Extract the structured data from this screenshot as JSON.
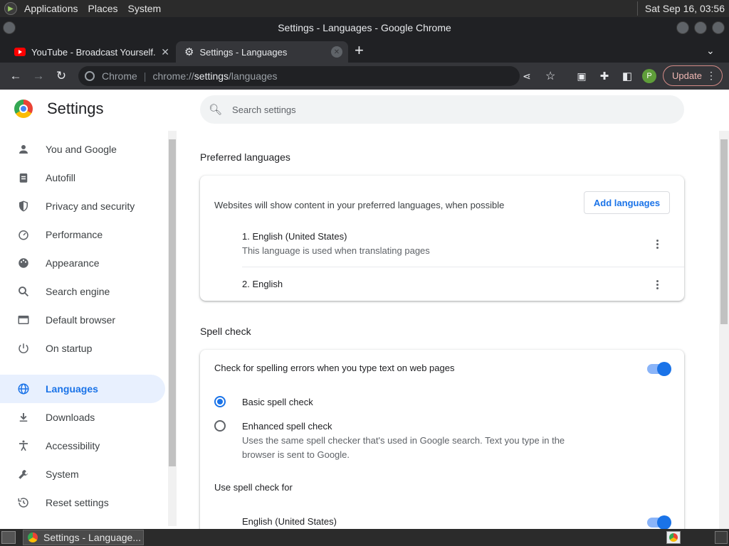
{
  "top_panel": {
    "menus": [
      "Applications",
      "Places",
      "System"
    ],
    "clock": "Sat Sep 16, 03:56"
  },
  "window": {
    "title": "Settings - Languages - Google Chrome"
  },
  "tabs": [
    {
      "title": "YouTube - Broadcast Yourself.",
      "icon": "youtube-icon",
      "active": false
    },
    {
      "title": "Settings - Languages",
      "icon": "gear-icon",
      "active": true
    }
  ],
  "toolbar": {
    "omnibox_site": "Chrome",
    "omnibox_url_prefix": "chrome://",
    "omnibox_url_host": "settings",
    "omnibox_url_path": "/languages",
    "profile_initial": "P",
    "update_label": "Update"
  },
  "settings": {
    "title": "Settings",
    "search_placeholder": "Search settings",
    "nav": [
      {
        "label": "You and Google",
        "icon": "person-icon"
      },
      {
        "label": "Autofill",
        "icon": "clipboard-icon"
      },
      {
        "label": "Privacy and security",
        "icon": "shield-icon"
      },
      {
        "label": "Performance",
        "icon": "speedometer-icon"
      },
      {
        "label": "Appearance",
        "icon": "palette-icon"
      },
      {
        "label": "Search engine",
        "icon": "search-icon"
      },
      {
        "label": "Default browser",
        "icon": "browser-icon"
      },
      {
        "label": "On startup",
        "icon": "power-icon"
      },
      {
        "label": "Languages",
        "icon": "globe-icon",
        "active": true
      },
      {
        "label": "Downloads",
        "icon": "download-icon"
      },
      {
        "label": "Accessibility",
        "icon": "accessibility-icon"
      },
      {
        "label": "System",
        "icon": "wrench-icon"
      },
      {
        "label": "Reset settings",
        "icon": "history-icon"
      }
    ]
  },
  "preferred_languages": {
    "heading": "Preferred languages",
    "description": "Websites will show content in your preferred languages, when possible",
    "add_button": "Add languages",
    "languages": [
      {
        "name": "1. English (United States)",
        "note": "This language is used when translating pages"
      },
      {
        "name": "2. English",
        "note": ""
      }
    ]
  },
  "spell_check": {
    "heading": "Spell check",
    "toggle_label": "Check for spelling errors when you type text on web pages",
    "toggle_on": true,
    "basic_label": "Basic spell check",
    "enhanced_label": "Enhanced spell check",
    "enhanced_desc_line1": "Uses the same spell checker that's used in Google search. Text you type in the",
    "enhanced_desc_line2": "browser is sent to Google.",
    "selected": "basic",
    "use_for_label": "Use spell check for",
    "languages": [
      {
        "name": "English (United States)",
        "enabled": true
      }
    ]
  },
  "taskbar": {
    "window_label": "Settings - Language..."
  },
  "colors": {
    "accent": "#1a73e8",
    "chrome_dark": "#35363a",
    "tab_bar": "#202124"
  }
}
